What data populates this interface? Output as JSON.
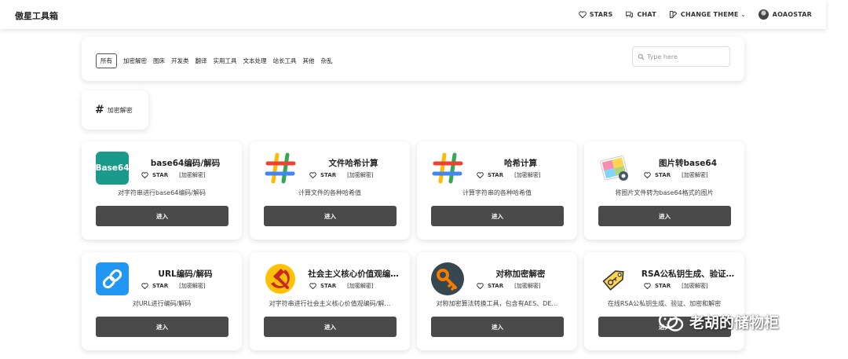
{
  "header": {
    "brand": "傲星工具箱",
    "nav": {
      "stars": "STARS",
      "chat": "CHAT",
      "theme": "CHANGE THEME",
      "user": "AOAOSTAR"
    }
  },
  "filter": {
    "tabs": [
      "所有",
      "加密解密",
      "图床",
      "开发类",
      "翻译",
      "实用工具",
      "文本处理",
      "站长工具",
      "其他",
      "杂乱"
    ],
    "active_tab": "所有",
    "search_placeholder": "Type here"
  },
  "category": {
    "hash": "#",
    "label": "加密解密"
  },
  "tools": [
    {
      "title": "base64编码/解码",
      "star": "STAR",
      "tag": "[加密解密]",
      "desc": "对字符串进行base64编码/解码",
      "button": "进入",
      "icon": "base64-icon",
      "icon_text": "Base64"
    },
    {
      "title": "文件哈希计算",
      "star": "STAR",
      "tag": "[加密解密]",
      "desc": "计算文件的各种哈希值",
      "button": "进入",
      "icon": "colorful-hash-icon"
    },
    {
      "title": "哈希计算",
      "star": "STAR",
      "tag": "[加密解密]",
      "desc": "计算字符串的各种哈希值",
      "button": "进入",
      "icon": "colorful-hash-icon"
    },
    {
      "title": "图片转base64",
      "star": "STAR",
      "tag": "[加密解密]",
      "desc": "将图片文件转为base64格式的图片",
      "button": "进入",
      "icon": "image-icon"
    },
    {
      "title": "URL编码/解码",
      "star": "STAR",
      "tag": "[加密解密]",
      "desc": "对URL进行编码/解码",
      "button": "进入",
      "icon": "link-icon"
    },
    {
      "title": "社会主义核心价值观编…",
      "star": "STAR",
      "tag": "[加密解密]",
      "desc": "对字符串进行社会主义核心价值观编码/解…",
      "button": "进入",
      "icon": "hammer-sickle-icon"
    },
    {
      "title": "对称加密解密",
      "star": "STAR",
      "tag": "[加密解密]",
      "desc": "对称加密算法转换工具，包含有AES、DE…",
      "button": "进入",
      "icon": "key-icon"
    },
    {
      "title": "RSA公私钥生成、验证…",
      "star": "STAR",
      "tag": "[加密解密]",
      "desc": "在线RSA公私钥生成、验证、加密和解密",
      "button": "进入",
      "icon": "key-tag-icon"
    }
  ],
  "watermark": "老胡的储物柜",
  "colors": {
    "button": "#4a4a4a",
    "base64_tile": "#1a9a8a",
    "link_tile": "#2196f3",
    "key_tile": "#37474f",
    "accent_orange": "#f57c00"
  }
}
